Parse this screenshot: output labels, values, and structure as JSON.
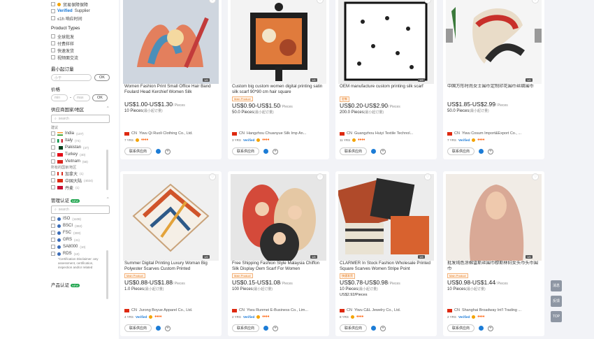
{
  "filters": {
    "top_items": [
      {
        "label": "贸易保障保障",
        "has_icon": true
      },
      {
        "label": "Supplier",
        "badge": "Verified"
      },
      {
        "label": "≤1h 响应时间"
      }
    ],
    "product_types_title": "Product Types",
    "product_types": [
      "全球批发",
      "付费样样",
      "快速发货",
      "视频面交流"
    ],
    "min_order_title": "最小起订量",
    "min_order_placeholder": "小于",
    "ok_label": "OK",
    "price_title": "价格",
    "price_min": "min",
    "price_max": "max",
    "region_title": "供应商国家/地区",
    "region_search": "search",
    "region_group1": "建议",
    "regions": [
      {
        "name": "India",
        "count": "(107)",
        "flag": "in"
      },
      {
        "name": "Italy",
        "count": "(74)",
        "flag": "it"
      },
      {
        "name": "Pakistan",
        "count": "(47)",
        "flag": "pk"
      },
      {
        "name": "Turkey",
        "count": "(40)",
        "flag": "tr"
      },
      {
        "name": "Vietnam",
        "count": "(58)",
        "flag": "vn"
      }
    ],
    "region_group2": "所有的国家/地区",
    "regions2": [
      {
        "name": "加拿大",
        "count": "(1)",
        "flag": "ca"
      },
      {
        "name": "中国大陆",
        "count": "(4024)",
        "flag": "cn"
      },
      {
        "name": "丹麦",
        "count": "(1)",
        "flag": "dk"
      }
    ],
    "cert_title": "管理认证",
    "cert_new": "NEW",
    "cert_search": "search",
    "certs": [
      {
        "name": "ISO",
        "count": "(1108)"
      },
      {
        "name": "BSCI",
        "count": "(382)"
      },
      {
        "name": "FSC",
        "count": "(300)"
      },
      {
        "name": "GRS",
        "count": "(41)"
      },
      {
        "name": "SA8000",
        "count": "(10)"
      },
      {
        "name": "RDS",
        "count": "(10)"
      }
    ],
    "cert_note": "*Certification Disclaimer: any assessment, certification, inspection and/or related",
    "product_cert_title": "产品认证",
    "product_cert_new": "NEW"
  },
  "products": [
    {
      "title": "Women Fashion Print Small Office Hair Band Foulard Head Kerchief Women Silk",
      "price": "US$1.00-US$1.30",
      "unit": "/ Pieces",
      "moq": "10 Pieces",
      "moq_note": "(最小起订量)",
      "supplier": "Yiwu Qi Ruoli Clothing Co., Ltd.",
      "country": "CN",
      "years": "7 YRS",
      "verified": "",
      "counter": "1/6",
      "tag": ""
    },
    {
      "title": "Custom big custom women digital printing satin silk scarf 90*90 cm hair square",
      "price": "US$0.90-US$1.50",
      "unit": "/ Pieces",
      "moq": "50.0 Pieces",
      "moq_note": "(最小起订量)",
      "supplier": "Hangzhou Chuanyue Silk Imp An...",
      "country": "CN",
      "years": "3 YRS",
      "verified": "Verified",
      "counter": "1/6",
      "tag": "Main Product"
    },
    {
      "title": "OEM manufacture custom printing silk scarf",
      "price": "US$0.20-US$2.90",
      "unit": "/ Pieces",
      "moq": "200.0 Pieces",
      "moq_note": "(最小起订量)",
      "supplier": "Guangzhou Huiyi Textile Technol...",
      "country": "CN",
      "years": "11 YRS",
      "verified": "",
      "counter": "1/6",
      "tag": "定制"
    },
    {
      "title": "中国方形时尚女士围巾定制印花围巾丝绸围巾",
      "price": "US$1.85-US$2.99",
      "unit": "/ Pieces",
      "moq": "50.0 Pieces",
      "moq_note": "(最小起订量)",
      "supplier": "Yiwu Cosum Import&Export Co., ...",
      "country": "CN",
      "years": "7 YRS",
      "verified": "Verified",
      "counter": "1/6",
      "tag": ""
    },
    {
      "title": "Summer Digital Printing Luxury Woman Big Polyester Scarves Custom Printed",
      "price": "US$0.88-US$1.88",
      "unit": "/ Pieces",
      "moq": "1.0 Pieces",
      "moq_note": "(最小起订量)",
      "supplier": "Jurong Boyue Apparel Co., Ltd.",
      "country": "CN",
      "years": "4 YRS",
      "verified": "Verified",
      "counter": "1/6",
      "tag": "Main Product"
    },
    {
      "title": "Free Shipping Fashion Style Malaysia Chiffon Silk Display Oem Scarf For Women",
      "price": "US$0.15-US$1.08",
      "unit": "/ Pieces",
      "moq": "100 Pieces",
      "moq_note": "(最小起订量)",
      "supplier": "Yiwu Runmei E-Business Co., Lim...",
      "country": "CN",
      "years": "2 YRS",
      "verified": "Verified",
      "counter": "1/6",
      "tag": "Main Product"
    },
    {
      "title": "CLARMER In Stock Fashion Wholesale Printed Square Scarves Women Stripe Point",
      "price": "US$0.78-US$0.98",
      "unit": "/ Pieces",
      "moq": "10 Pieces",
      "moq_note": "(最小起订量)",
      "supplier": "Yiwu C&L Jewelry Co., Ltd.",
      "country": "CN",
      "years": "8 YRS",
      "verified": "",
      "counter": "1/6",
      "tag": "快速发货",
      "sample": "US$2.92/Pieces"
    },
    {
      "title": "批发纯色涂棉雷斯丝围巾穆斯林妇女头巾头巾围巾",
      "price": "US$0.98-US$1.44",
      "unit": "/ Pieces",
      "moq": "10 Pieces",
      "moq_note": "(最小起订量)",
      "supplier": "Shanghai Broadway Int'l Trading ...",
      "country": "CN",
      "years": "2 YRS",
      "verified": "Verified",
      "counter": "1/6",
      "tag": "Main Product"
    }
  ],
  "contact_label": "联系供应商",
  "float_buttons": {
    "chat": "消息",
    "feedback": "反馈",
    "top": "TOP"
  }
}
